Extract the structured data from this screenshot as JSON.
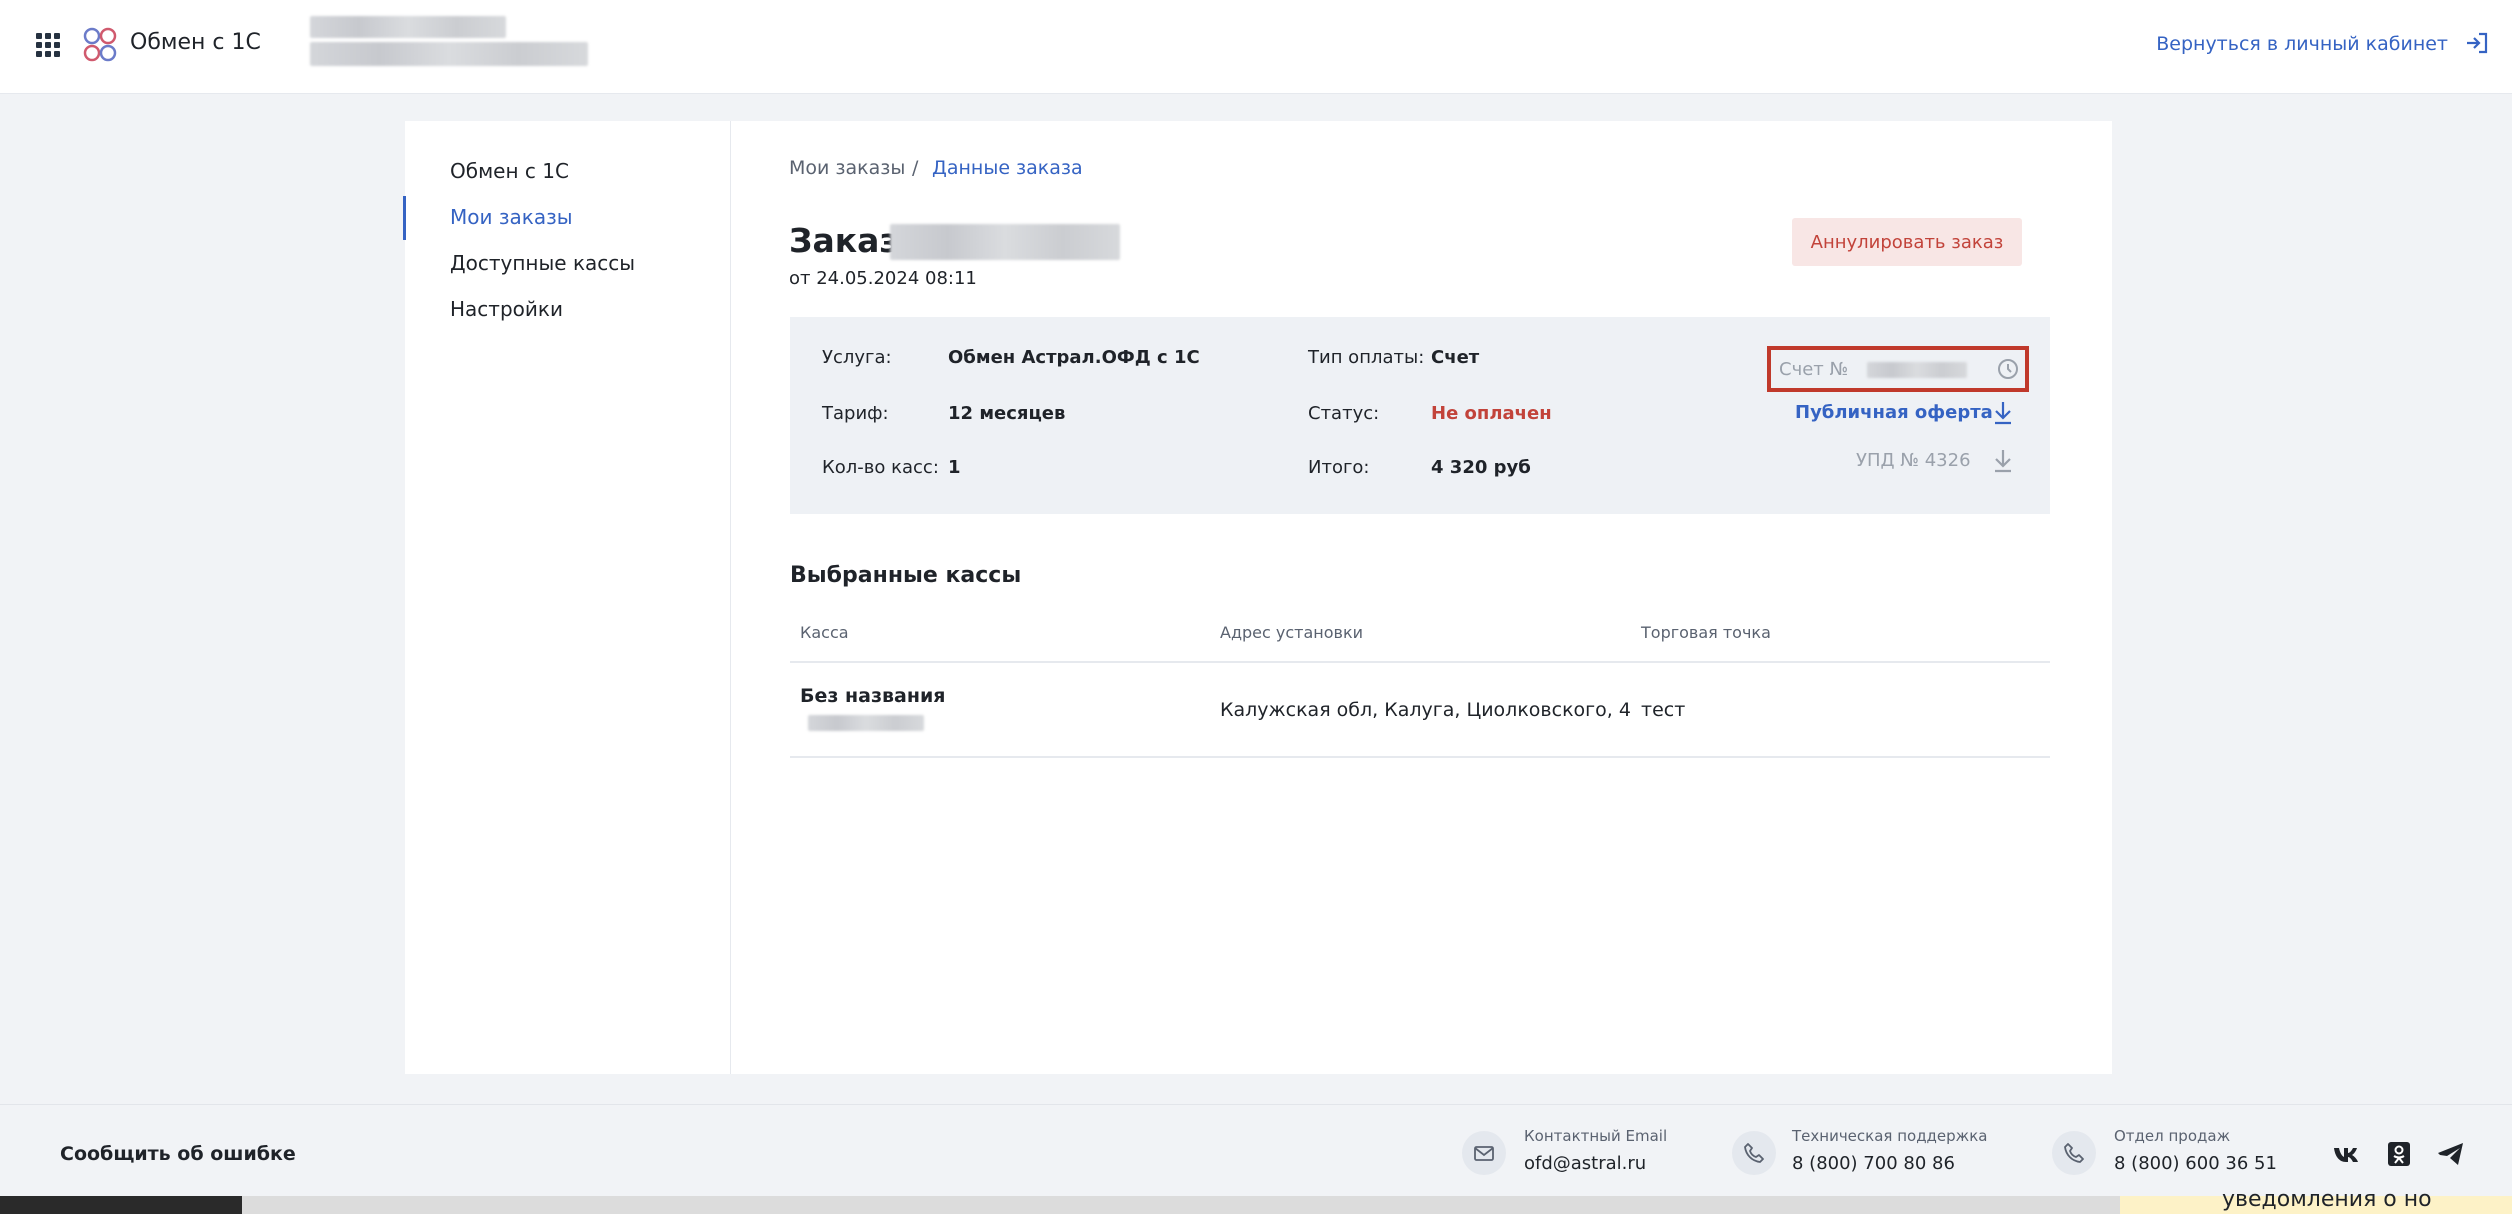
{
  "header": {
    "app_title": "Обмен с 1С",
    "return_link": "Вернуться в личный кабинет"
  },
  "sidebar": {
    "items": [
      {
        "label": "Обмен с 1С"
      },
      {
        "label": "Мои заказы",
        "active": true
      },
      {
        "label": "Доступные кассы"
      },
      {
        "label": "Настройки"
      }
    ]
  },
  "breadcrumb": {
    "parent": "Мои заказы",
    "separator": "/",
    "current": "Данные заказа"
  },
  "order": {
    "title": "Заказ",
    "date": "от 24.05.2024 08:11",
    "cancel_button": "Аннулировать заказ"
  },
  "info": {
    "service_label": "Услуга:",
    "service_value": "Обмен Астрал.ОФД с 1С",
    "tariff_label": "Тариф:",
    "tariff_value": "12 месяцев",
    "kkt_label": "Кол-во касс:",
    "kkt_value": "1",
    "payment_label": "Тип оплаты:",
    "payment_value": "Счет",
    "status_label": "Статус:",
    "status_value": "Не оплачен",
    "total_label": "Итого:",
    "total_value": "4 320 руб",
    "invoice_label": "Счет №",
    "offer_link": "Публичная оферта",
    "upd_label": "УПД № 4326"
  },
  "colors": {
    "accent": "#3563c3",
    "danger": "#c2433a",
    "highlight_border": "#c0392b"
  },
  "selected": {
    "title": "Выбранные кассы",
    "columns": [
      "Касса",
      "Адрес установки",
      "Торговая точка"
    ],
    "rows": [
      {
        "kassa": "Без названия",
        "address": "Калужская обл, Калуга, Циолковского, 4",
        "point": "тест"
      }
    ]
  },
  "footer": {
    "report": "Сообщить об ошибке",
    "email_label": "Контактный Email",
    "email_value": "ofd@astral.ru",
    "support_label": "Техническая поддержка",
    "support_value": "8 (800) 700 80 86",
    "sales_label": "Отдел продаж",
    "sales_value": "8 (800) 600 36 51"
  },
  "bottom_strip_text": "уведомления о но",
  "icons": [
    "apps-grid-icon",
    "logo-icon",
    "logout-icon",
    "clock-icon",
    "download-icon",
    "mail-icon",
    "phone-icon",
    "vk-icon",
    "ok-icon",
    "telegram-icon"
  ]
}
